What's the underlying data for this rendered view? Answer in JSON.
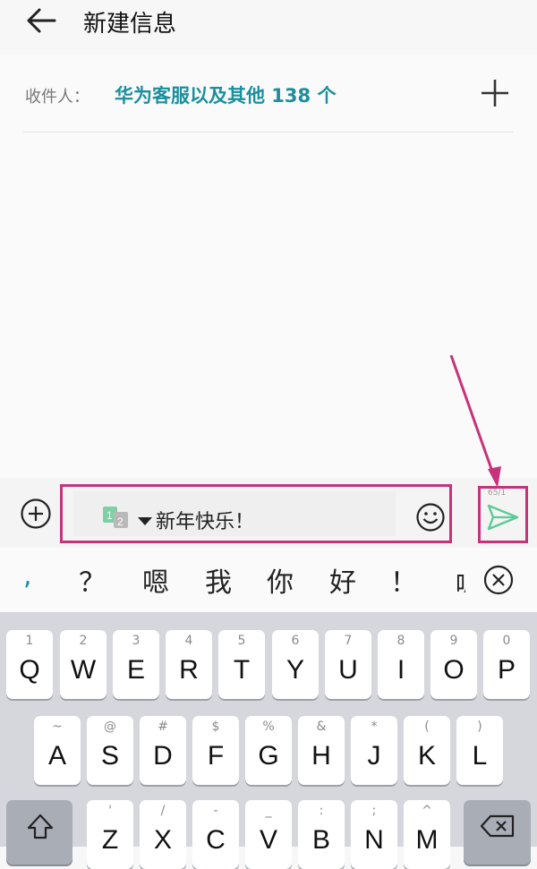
{
  "header": {
    "title": "新建信息"
  },
  "recipients": {
    "label": "收件人：",
    "value": "华为客服以及其他 138 个"
  },
  "compose": {
    "sim_primary": "1",
    "sim_secondary": "2",
    "message_text": "新年快乐！",
    "counter": "65/1"
  },
  "suggestions": [
    ",",
    "？",
    "嗯",
    "我",
    "你",
    "好",
    "！"
  ],
  "suggestion_cut": "呢",
  "keyboard": {
    "row1": [
      {
        "hint": "1",
        "char": "Q"
      },
      {
        "hint": "2",
        "char": "W"
      },
      {
        "hint": "3",
        "char": "E"
      },
      {
        "hint": "4",
        "char": "R"
      },
      {
        "hint": "5",
        "char": "T"
      },
      {
        "hint": "6",
        "char": "Y"
      },
      {
        "hint": "7",
        "char": "U"
      },
      {
        "hint": "8",
        "char": "I"
      },
      {
        "hint": "9",
        "char": "O"
      },
      {
        "hint": "0",
        "char": "P"
      }
    ],
    "row2": [
      {
        "hint": "~",
        "char": "A"
      },
      {
        "hint": "@",
        "char": "S"
      },
      {
        "hint": "#",
        "char": "D"
      },
      {
        "hint": "$",
        "char": "F"
      },
      {
        "hint": "%",
        "char": "G"
      },
      {
        "hint": "&",
        "char": "H"
      },
      {
        "hint": "*",
        "char": "J"
      },
      {
        "hint": "(",
        "char": "K"
      },
      {
        "hint": ")",
        "char": "L"
      }
    ],
    "row3": [
      {
        "hint": "'",
        "char": "Z"
      },
      {
        "hint": "/",
        "char": "X"
      },
      {
        "hint": "-",
        "char": "C"
      },
      {
        "hint": "_",
        "char": "V"
      },
      {
        "hint": ":",
        "char": "B"
      },
      {
        "hint": ";",
        "char": "N"
      },
      {
        "hint": "^",
        "char": "M"
      }
    ]
  },
  "colors": {
    "accent": "#1b8f9e",
    "highlight": "#c8327a",
    "send_green": "#5cc99a"
  },
  "icons": [
    "back-arrow-icon",
    "add-recipient-icon",
    "plus-circle-icon",
    "emoji-icon",
    "send-icon",
    "close-circle-icon",
    "shift-icon",
    "backspace-icon"
  ]
}
